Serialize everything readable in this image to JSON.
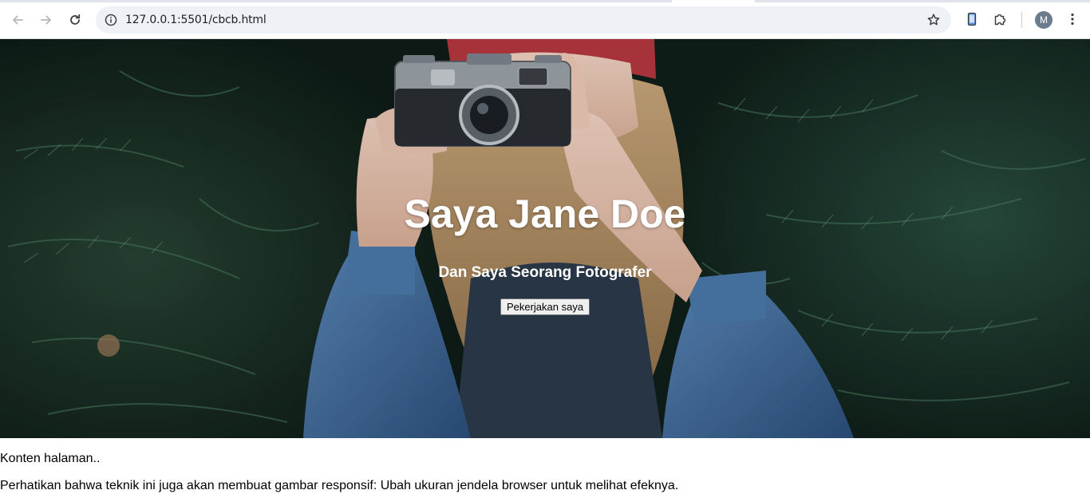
{
  "browser": {
    "url": "127.0.0.1:5501/cbcb.html",
    "profile_initial": "M",
    "icons": {
      "back": "arrow-left-icon",
      "forward": "arrow-right-icon",
      "reload": "reload-icon",
      "site_info": "info-icon",
      "bookmark": "star-icon",
      "reading_mode": "phone-icon",
      "extensions": "puzzle-icon",
      "menu": "kebab-menu-icon"
    }
  },
  "hero": {
    "title": "Saya Jane Doe",
    "subtitle": "Dan Saya Seorang Fotografer",
    "button_label": "Pekerjakan saya",
    "image": "photo of woman holding a camera in front of pine trees"
  },
  "content": {
    "paragraph_1": "Konten halaman..",
    "paragraph_2": "Perhatikan bahwa teknik ini juga akan membuat gambar responsif: Ubah ukuran jendela browser untuk melihat efeknya."
  },
  "colors": {
    "hero_text": "#ffffff",
    "omnibox_bg": "#eef1f6",
    "denim": "#3d6a9c",
    "foliage": "#2f5a45"
  }
}
